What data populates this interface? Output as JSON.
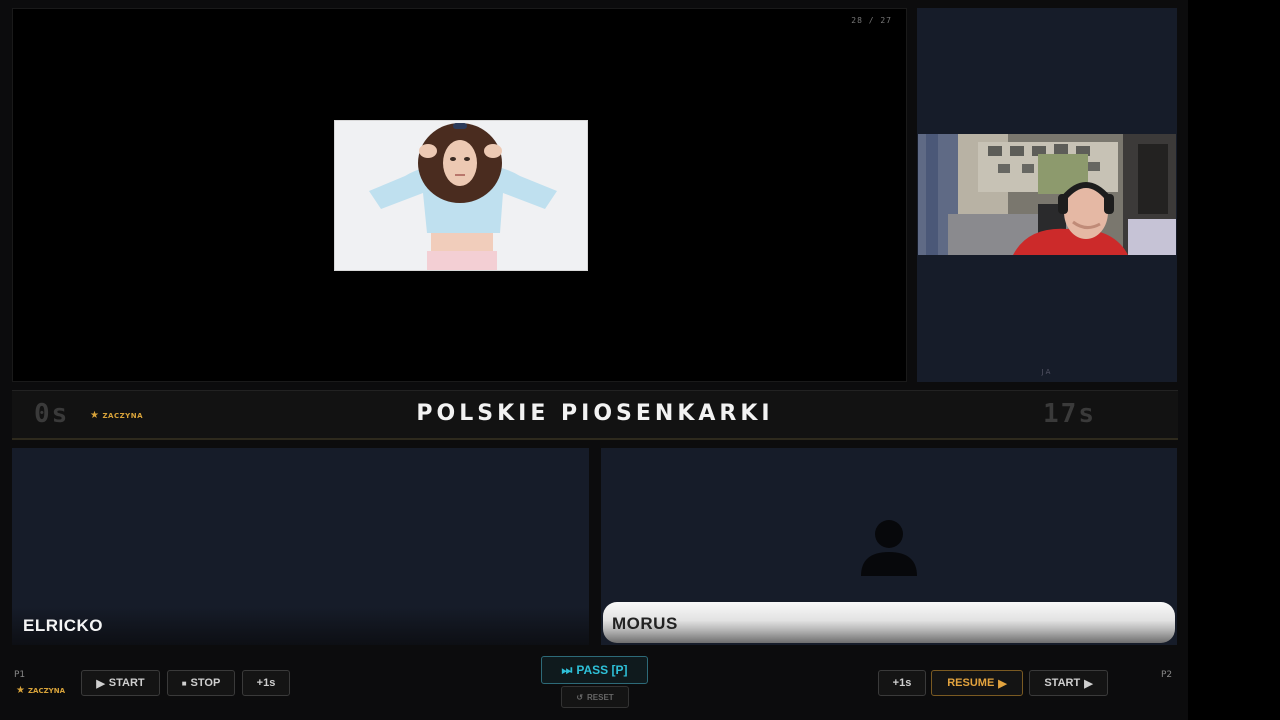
{
  "question": {
    "counter": "28 / 27",
    "category": "POLSKIE PIOSENKARKI"
  },
  "camera": {
    "caption": "JA"
  },
  "timer": {
    "left": "0s",
    "right": "17s",
    "starts_label": "ZACZYNA"
  },
  "players": {
    "p1": {
      "name": "ELRICKO",
      "label": "P1",
      "starts_label": "ZACZYNA"
    },
    "p2": {
      "name": "MORUS",
      "label": "P2"
    }
  },
  "controls": {
    "p1": {
      "start": "START",
      "stop": "STOP",
      "plus": "+1s"
    },
    "center": {
      "pass": "PASS [P]",
      "reset": "RESET"
    },
    "p2": {
      "plus": "+1s",
      "resume": "RESUME",
      "start": "START"
    }
  },
  "icons": {
    "star": "star-icon",
    "play": "play-icon",
    "stop": "stop-icon",
    "skip": "skip-icon",
    "reset": "reset-icon",
    "avatar": "user-icon"
  },
  "colors": {
    "accent_gold": "#d8a33a",
    "accent_cyan": "#2ec0d8",
    "panel_bg": "#161c29"
  }
}
